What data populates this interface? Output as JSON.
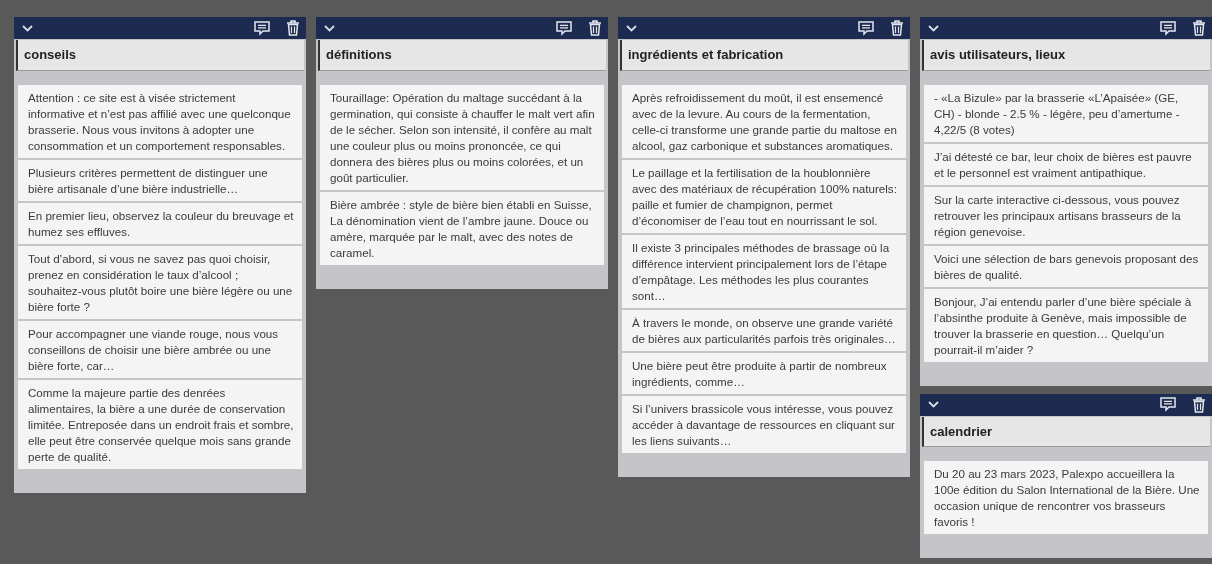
{
  "columns": [
    {
      "lists": [
        {
          "title": "conseils",
          "cards": [
            "Attention : ce site est à visée strictement informative et n’est pas affilié avec une quelconque brasserie. Nous vous invitons à adopter une consommation et un comportement responsables.",
            "Plusieurs critères permettent de distinguer une bière artisanale d’une bière industrielle…",
            "En premier lieu, observez la couleur du breuvage et humez ses effluves.",
            "Tout d’abord, si vous ne savez pas quoi choisir, prenez en considération le taux d’alcool ; souhaitez-vous plutôt boire une bière légère ou une bière forte ?",
            "Pour accompagner une viande rouge, nous vous conseillons de choisir une bière ambrée ou une bière forte, car…",
            "Comme la majeure partie des denrées alimentaires, la bière a une durée de conservation limitée. Entreposée dans un endroit frais et sombre, elle peut être conservée quelque mois sans grande perte de qualité."
          ]
        }
      ]
    },
    {
      "lists": [
        {
          "title": "définitions",
          "cards": [
            "Touraillage: Opération du maltage succédant à la germination, qui consiste à chauffer le malt vert afin de le sécher. Selon son intensité, il confère au malt une couleur plus ou moins prononcée, ce qui donnera des bières plus ou moins colorées, et un goût particulier.",
            "Bière ambrée : style de bière bien établi en Suisse, La dénomination vient de l’ambre jaune. Douce ou amère, marquée par le malt, avec des notes de caramel."
          ]
        }
      ]
    },
    {
      "lists": [
        {
          "title": "ingrédients et fabrication",
          "cards": [
            "Après refroidissement du moût, il est ensemencé avec de la levure. Au cours de la fermentation, celle-ci transforme une grande partie du maltose en alcool, gaz carbonique et substances aromatiques.",
            "Le paillage et la fertilisation de la houblonnière avec des matériaux de récupération 100% naturels: paille et fumier de champignon, permet d’économiser de l’eau tout en nourrissant le sol.",
            "Il existe 3 principales méthodes de brassage où la différence intervient principalement lors de l’étape d’empâtage. Les méthodes les plus courantes sont…",
            "À travers le monde, on observe une grande variété de bières aux particularités parfois très originales…",
            "Une bière peut être produite à partir de nombreux ingrédients, comme…",
            "Si l’univers brassicole vous intéresse, vous pouvez accéder à davantage de ressources en cliquant sur les liens suivants…"
          ]
        }
      ]
    },
    {
      "lists": [
        {
          "title": "avis utilisateurs, lieux",
          "cards": [
            "- «La Bizule» par la brasserie «L’Apaisée» (GE, CH) - blonde - 2.5 % - légère, peu d’amertume - 4,22/5 (8 votes)",
            "J’ai détesté ce bar, leur choix de bières est pauvre et le personnel est vraiment antipathique.",
            "Sur la carte interactive ci-dessous, vous pouvez retrouver les principaux artisans brasseurs de la région genevoise.",
            "Voici une sélection de bars genevois proposant des bières de qualité.",
            "Bonjour, J’ai entendu parler d’une bière spéciale à l’absinthe produite à Genève, mais impossible de trouver la brasserie en question… Quelqu’un pourrait-il m’aider ?"
          ]
        },
        {
          "title": "calendrier",
          "cards": [
            "Du 20 au 23 mars 2023, Palexpo accueillera la 100e édition du Salon International de la Bière. Une occasion unique de rencontrer vos brasseurs favoris !"
          ]
        }
      ]
    }
  ]
}
